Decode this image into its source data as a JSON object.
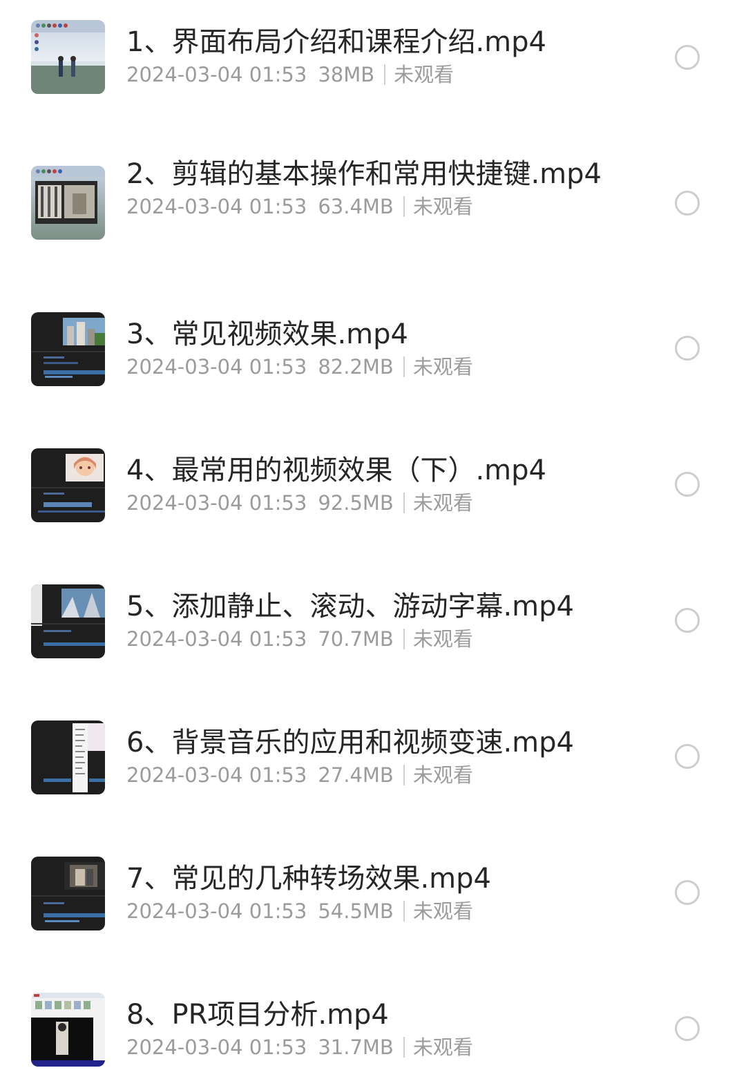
{
  "files": [
    {
      "title": "1、界面布局介绍和课程介绍.mp4",
      "date": "2024-03-04 01:53",
      "size": "38MB",
      "status": "未观看",
      "thumb": "anime-sky"
    },
    {
      "title": "2、剪辑的基本操作和常用快捷键.mp4",
      "date": "2024-03-04 01:53",
      "size": "63.4MB",
      "status": "未观看",
      "thumb": "anime-sky-editor"
    },
    {
      "title": "3、常见视频效果.mp4",
      "date": "2024-03-04 01:53",
      "size": "82.2MB",
      "status": "未观看",
      "thumb": "editor-city"
    },
    {
      "title": "4、最常用的视频效果（下）.mp4",
      "date": "2024-03-04 01:53",
      "size": "92.5MB",
      "status": "未观看",
      "thumb": "editor-anime-girl"
    },
    {
      "title": "5、添加静止、滚动、游动字幕.mp4",
      "date": "2024-03-04 01:53",
      "size": "70.7MB",
      "status": "未观看",
      "thumb": "editor-sky"
    },
    {
      "title": "6、背景音乐的应用和视频变速.mp4",
      "date": "2024-03-04 01:53",
      "size": "27.4MB",
      "status": "未观看",
      "thumb": "editor-menu"
    },
    {
      "title": "7、常见的几种转场效果.mp4",
      "date": "2024-03-04 01:53",
      "size": "54.5MB",
      "status": "未观看",
      "thumb": "editor-room"
    },
    {
      "title": "8、PR项目分析.mp4",
      "date": "2024-03-04 01:53",
      "size": "31.7MB",
      "status": "未观看",
      "thumb": "project-window"
    }
  ],
  "colors": {
    "title": "#262626",
    "meta": "#9b9b9b",
    "circle": "#cdcdcd"
  }
}
